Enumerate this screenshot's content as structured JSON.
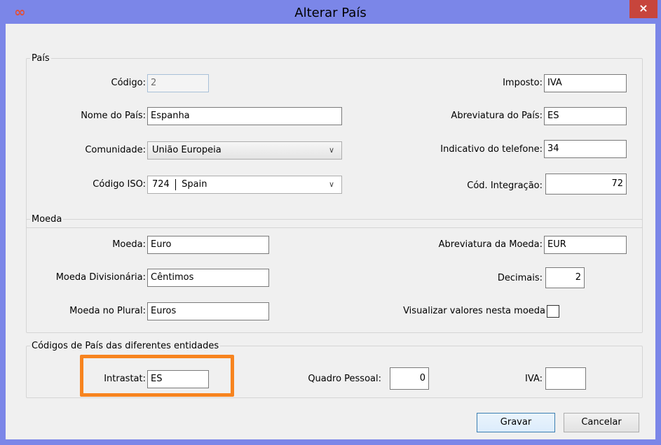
{
  "window": {
    "title": "Alterar País",
    "close_label": "×",
    "app_icon": "∞"
  },
  "pais": {
    "legend": "País",
    "codigo_label": "Código:",
    "codigo_value": "2",
    "nome_label": "Nome do País:",
    "nome_value": "Espanha",
    "comunidade_label": "Comunidade:",
    "comunidade_value": "União Europeia",
    "iso_label": "Código ISO:",
    "iso_code": "724",
    "iso_name": "Spain",
    "imposto_label": "Imposto:",
    "imposto_value": "IVA",
    "abrev_label": "Abreviatura do País:",
    "abrev_value": "ES",
    "tel_label": "Indicativo do telefone:",
    "tel_value": "34",
    "integ_label": "Cód. Integração:",
    "integ_value": "72"
  },
  "moeda": {
    "legend": "Moeda",
    "moeda_label": "Moeda:",
    "moeda_value": "Euro",
    "divisionaria_label": "Moeda Divisionária:",
    "divisionaria_value": "Cêntimos",
    "plural_label": "Moeda no Plural:",
    "plural_value": "Euros",
    "abrev_label": "Abreviatura da Moeda:",
    "abrev_value": "EUR",
    "decimais_label": "Decimais:",
    "decimais_value": "2",
    "visualizar_label": "Visualizar valores nesta moeda",
    "visualizar_checked": false
  },
  "codigos": {
    "legend": "Códigos de País das diferentes entidades",
    "intrastat_label": "Intrastat:",
    "intrastat_value": "ES",
    "quadro_label": "Quadro Pessoal:",
    "quadro_value": "0",
    "iva_label": "IVA:",
    "iva_value": ""
  },
  "buttons": {
    "gravar": "Gravar",
    "cancelar": "Cancelar"
  },
  "colors": {
    "titlebar": "#7b86e8",
    "close": "#c7453c",
    "highlight": "#f7841f"
  }
}
